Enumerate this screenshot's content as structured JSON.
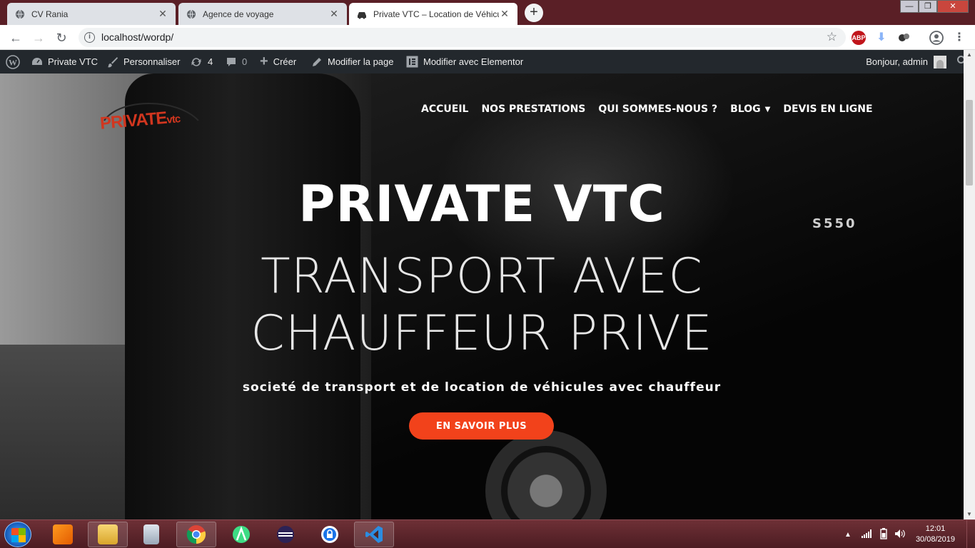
{
  "tabs": [
    {
      "title": "CV Rania",
      "close": "✕"
    },
    {
      "title": "Agence de voyage",
      "close": "✕"
    },
    {
      "title": "Private VTC – Location de Véhicu",
      "close": "✕"
    }
  ],
  "newtab": "+",
  "window_controls": {
    "minimize": "—",
    "maximize": "❐",
    "close": "✕"
  },
  "address_bar": {
    "url": "localhost/wordp/",
    "info": "i"
  },
  "extensions": {
    "abp": "ABP"
  },
  "adminbar": {
    "site_name": "Private VTC",
    "customize": "Personnaliser",
    "updates_count": "4",
    "comments_count": "0",
    "new": "Créer",
    "edit_page": "Modifier la page",
    "elementor": "Modifier avec Elementor",
    "greeting": "Bonjour, admin"
  },
  "hero": {
    "logo_main": "PRIVATE",
    "logo_suffix": "vtc",
    "nav": [
      "ACCUEIL",
      "NOS PRESTATIONS",
      "QUI SOMMES-NOUS ?",
      "BLOG",
      "DEVIS EN LIGNE"
    ],
    "title": "PRIVATE VTC",
    "subtitle_line1": "TRANSPORT AVEC",
    "subtitle_line2": "CHAUFFEUR PRIVE",
    "description": "societé de transport et de location de véhicules avec chauffeur",
    "cta": "EN SAVOIR PLUS",
    "car_badge": "S550"
  },
  "taskbar": {
    "time": "12:01",
    "date": "30/08/2019"
  },
  "colors": {
    "tabstrip": "#5a1f26",
    "adminbar": "#23282d",
    "accent": "#f2421b",
    "logo": "#d1361f"
  }
}
